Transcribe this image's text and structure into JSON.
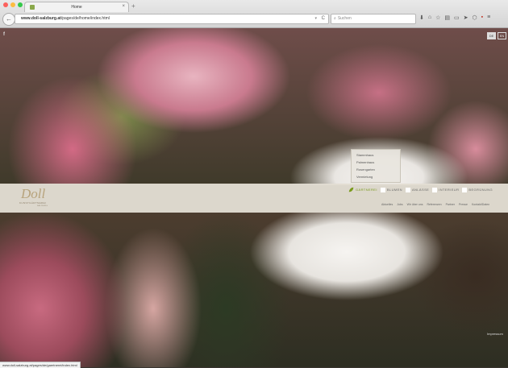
{
  "browser": {
    "tab_title": "Home",
    "tab_close": "×",
    "new_tab": "+",
    "back": "←",
    "url_host": "www.doll-salzburg.at",
    "url_path": "/pages/de/home/index.html",
    "url_dropdown": "▾",
    "reload": "C",
    "search_icon": "⌕",
    "search_placeholder": "Suchen",
    "toolbar_icons": [
      "download-icon",
      "home-icon",
      "bookmark-star-icon",
      "reader-icon",
      "chat-icon",
      "send-icon",
      "pocket-icon",
      "extension-icon",
      "menu-icon"
    ],
    "toolbar_glyphs": [
      "⬇",
      "⌂",
      "☆",
      "▤",
      "▭",
      "➤",
      "⬡",
      "▪",
      "≡"
    ],
    "traffic_lights": [
      "#fc605c",
      "#fdbc40",
      "#34c84a"
    ],
    "status_url": "www.doll-salzburg.at/pages/de/gaertnerei/index.html"
  },
  "site": {
    "facebook": "f",
    "languages": [
      "DE",
      "EN"
    ],
    "logo": {
      "script": "Doll",
      "tagline": "KUNSTGÄRTNEREI",
      "sub": "SALZBURG"
    },
    "nav": [
      {
        "label": "GÄRTNEREI",
        "active": true
      },
      {
        "label": "BLUMEN",
        "active": false
      },
      {
        "label": "ANLÄSSE",
        "active": false
      },
      {
        "label": "INTERIEUR",
        "active": false
      },
      {
        "label": "BEGRÜNUNG",
        "active": false
      }
    ],
    "dropdown": [
      "Stammhaus",
      "Palmenhaus",
      "Rosengarten",
      "Vermietung"
    ],
    "subnav": [
      "Aktuelles",
      "Jobs",
      "Wir über uns",
      "Referenzen",
      "Partner",
      "Presse",
      "Kontakt/Daten"
    ],
    "impressum": "Impressum",
    "accent": "#7a9a1c"
  }
}
